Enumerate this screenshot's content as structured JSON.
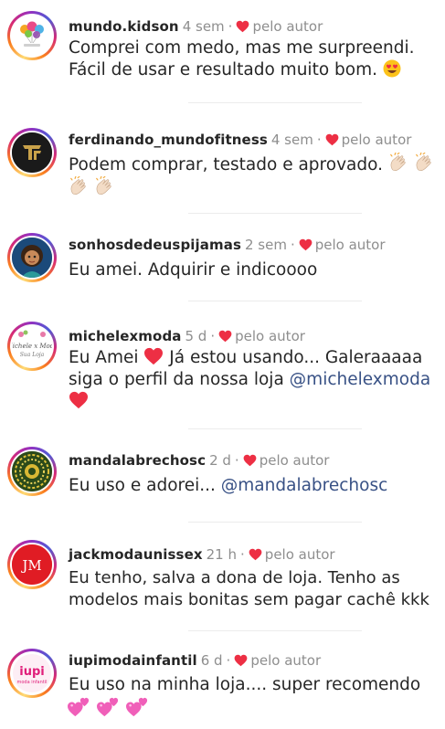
{
  "colors": {
    "accent_red": "#ed2f44",
    "muted": "#8e8e8e",
    "mention": "#385185",
    "text": "#262626"
  },
  "comments": [
    {
      "username": "mundo.kidson",
      "time": "4 sem",
      "sep": "·",
      "author_label": "pelo autor",
      "text_a": "Comprei com medo, mas me surpreendi.",
      "text_b": "Fácil de usar e resultado muito bom.",
      "emoji": "smiling-face-with-heart-eyes"
    },
    {
      "username": "ferdinando_mundofitness",
      "time": "4 sem",
      "sep": "·",
      "author_label": "pelo autor",
      "text_a": "Podem comprar, testado e aprovado.",
      "emoji": "clapping-hands"
    },
    {
      "username": "sonhosdedeuspijamas",
      "time": "2 sem",
      "sep": "·",
      "author_label": "pelo autor",
      "text_a": "Eu amei. Adquirir e indicoooo"
    },
    {
      "username": "michelexmoda",
      "time": "5 d",
      "sep": "·",
      "author_label": "pelo autor",
      "text_a": "Eu Amei",
      "text_b": "Já estou usando... Galeraaaaa",
      "text_c": "siga o perfil da nossa loja",
      "mention": "@michelexmoda",
      "emoji": "red-heart"
    },
    {
      "username": "mandalabrechosc",
      "time": "2 d",
      "sep": "·",
      "author_label": "pelo autor",
      "text_a": "Eu uso e adorei...",
      "mention": "@mandalabrechosc"
    },
    {
      "username": "jackmodaunissex",
      "time": "21 h",
      "sep": "·",
      "author_label": "pelo autor",
      "text_a": "Eu tenho, salva a dona de loja. Tenho as",
      "text_b": "modelos mais bonitas sem pagar cachê kkk"
    },
    {
      "username": "iupimodainfantil",
      "time": "6 d",
      "sep": "·",
      "author_label": "pelo autor",
      "text_a": "Eu uso na minha loja.... super recomendo",
      "emoji": "two-hearts"
    }
  ],
  "avatars": {
    "jack_initials": "JM",
    "iupi_brand": "iupi",
    "iupi_sub": "moda infantil",
    "michele_script": "Michele x Moda",
    "michele_sub": "Sua Loja"
  }
}
